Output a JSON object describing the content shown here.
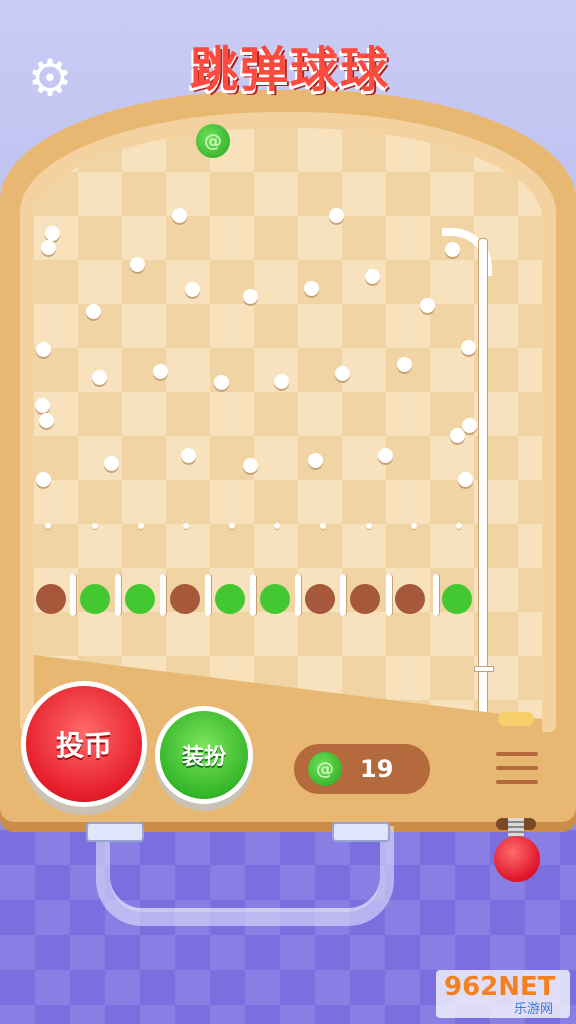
{
  "title": "跳弹球球",
  "settings_icon": "gear-icon",
  "buttons": {
    "insert_coin": "投币",
    "dress_up": "装扮"
  },
  "coin_count": "19",
  "coin_icon": "green-swirl-coin-icon",
  "menu_icon": "hamburger-menu-icon",
  "slots": [
    "brown",
    "green",
    "green",
    "brown",
    "green",
    "green",
    "brown",
    "brown",
    "brown",
    "green"
  ],
  "colors": {
    "brown_slot": "#a5583a",
    "green_slot": "#43c832",
    "red_button": "#e61e2b",
    "green_button": "#35b72a"
  },
  "watermark": {
    "main": "962NET",
    "sub": "乐游网"
  }
}
